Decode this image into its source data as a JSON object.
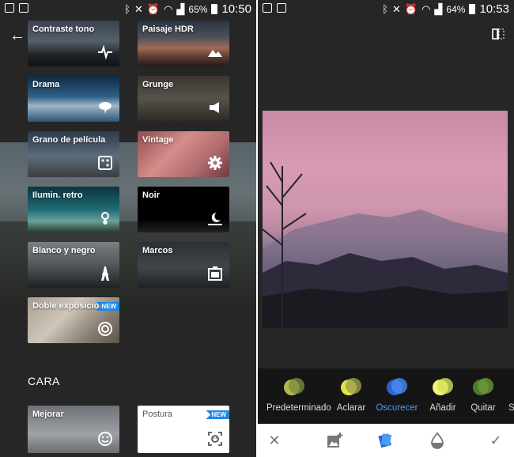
{
  "left_screen": {
    "status": {
      "battery": "65%",
      "time": "10:50"
    },
    "filters": [
      {
        "label": "Contraste tono",
        "icon": "pulse-icon"
      },
      {
        "label": "Paisaje HDR",
        "icon": "mountain-icon"
      },
      {
        "label": "Drama",
        "icon": "cloud-lightning-icon"
      },
      {
        "label": "Grunge",
        "icon": "megaphone-icon"
      },
      {
        "label": "Grano de película",
        "icon": "dice-icon"
      },
      {
        "label": "Vintage",
        "icon": "gear-icon"
      },
      {
        "label": "Ilumin. retro",
        "icon": "pin-icon"
      },
      {
        "label": "Noir",
        "icon": "moon-icon"
      },
      {
        "label": "Blanco y negro",
        "icon": "eiffel-tower-icon"
      },
      {
        "label": "Marcos",
        "icon": "frame-icon"
      },
      {
        "label": "Doble exposición",
        "icon": "double-circle-icon",
        "badge": "NEW"
      }
    ],
    "section_title": "CARA",
    "face_filters": [
      {
        "label": "Mejorar",
        "icon": "smile-icon"
      },
      {
        "label": "Postura",
        "icon": "face-scan-icon",
        "badge": "NEW"
      }
    ]
  },
  "right_screen": {
    "status": {
      "battery": "64%",
      "time": "10:53"
    },
    "options": [
      {
        "label": "Predeterminado",
        "c1": "#b7b84a",
        "c2": "#7b8c3c",
        "selected": false
      },
      {
        "label": "Aclarar",
        "c1": "#e2e34a",
        "c2": "#9ea04a",
        "selected": false
      },
      {
        "label": "Oscurecer",
        "c1": "#2d63d0",
        "c2": "#4a8cf0",
        "selected": true
      },
      {
        "label": "Añadir",
        "c1": "#f5f47a",
        "c2": "#cfe05a",
        "selected": false
      },
      {
        "label": "Quitar",
        "c1": "#4c7a2a",
        "c2": "#6d9a3a",
        "selected": false
      },
      {
        "label": "S",
        "c1": "#777",
        "c2": "#777",
        "selected": false
      }
    ],
    "colors": {
      "accent": "#4a9bf5",
      "badge": "#1e88e5"
    }
  }
}
